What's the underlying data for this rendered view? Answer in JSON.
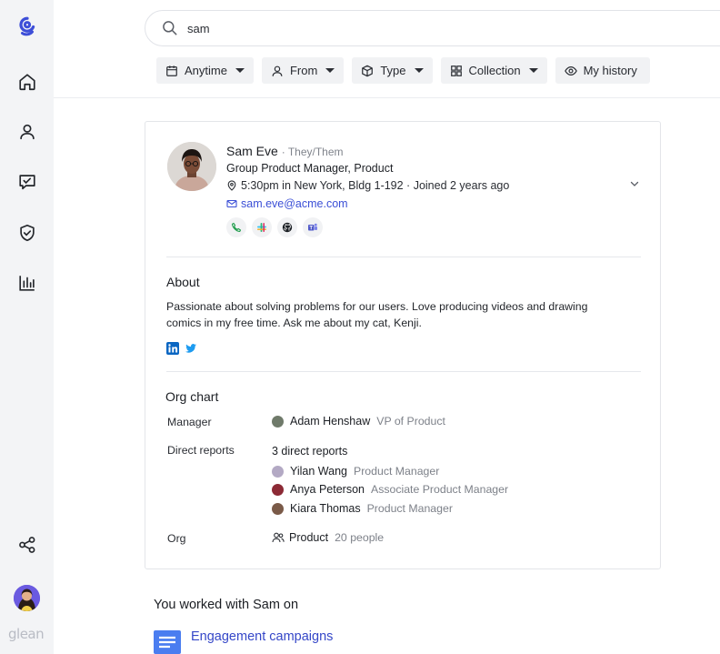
{
  "search": {
    "query": "sam"
  },
  "filters": [
    {
      "label": "Anytime",
      "icon": "calendar-icon"
    },
    {
      "label": "From",
      "icon": "person-icon"
    },
    {
      "label": "Type",
      "icon": "cube-icon"
    },
    {
      "label": "Collection",
      "icon": "grid-icon"
    },
    {
      "label": "My history",
      "icon": "eye-icon"
    }
  ],
  "sidebar": {
    "items": [
      "home-icon",
      "people-icon",
      "tasks-icon",
      "shield-icon",
      "analytics-icon"
    ],
    "footer": [
      "share-icon"
    ],
    "brand": "glean"
  },
  "person": {
    "name": "Sam Eve",
    "pronouns": "· They/Them",
    "title": "Group Product Manager, Product",
    "location": "5:30pm in New York, Bldg 1-192 · Joined 2 years ago",
    "email": "sam.eve@acme.com",
    "apps": [
      "phone-icon",
      "slack-icon",
      "github-icon",
      "teams-icon"
    ]
  },
  "about": {
    "heading": "About",
    "text": "Passionate about solving problems for our users. Love producing videos and drawing comics in my free time. Ask me about my cat, Kenji."
  },
  "org": {
    "heading": "Org chart",
    "manager_label": "Manager",
    "manager": {
      "name": "Adam Henshaw",
      "role": "VP of Product"
    },
    "reports_label": "Direct reports",
    "reports_count": "3 direct reports",
    "reports": [
      {
        "name": "Yilan Wang",
        "role": "Product Manager"
      },
      {
        "name": "Anya Peterson",
        "role": "Associate Product Manager"
      },
      {
        "name": "Kiara Thomas",
        "role": "Product Manager"
      }
    ],
    "org_label": "Org",
    "org_name": "Product",
    "org_size": "20 people"
  },
  "worked_with": {
    "heading": "You worked with Sam on",
    "doc_title": "Engagement campaigns"
  },
  "colors": {
    "brand": "#3d4ed8",
    "link": "#3b4fd6"
  }
}
